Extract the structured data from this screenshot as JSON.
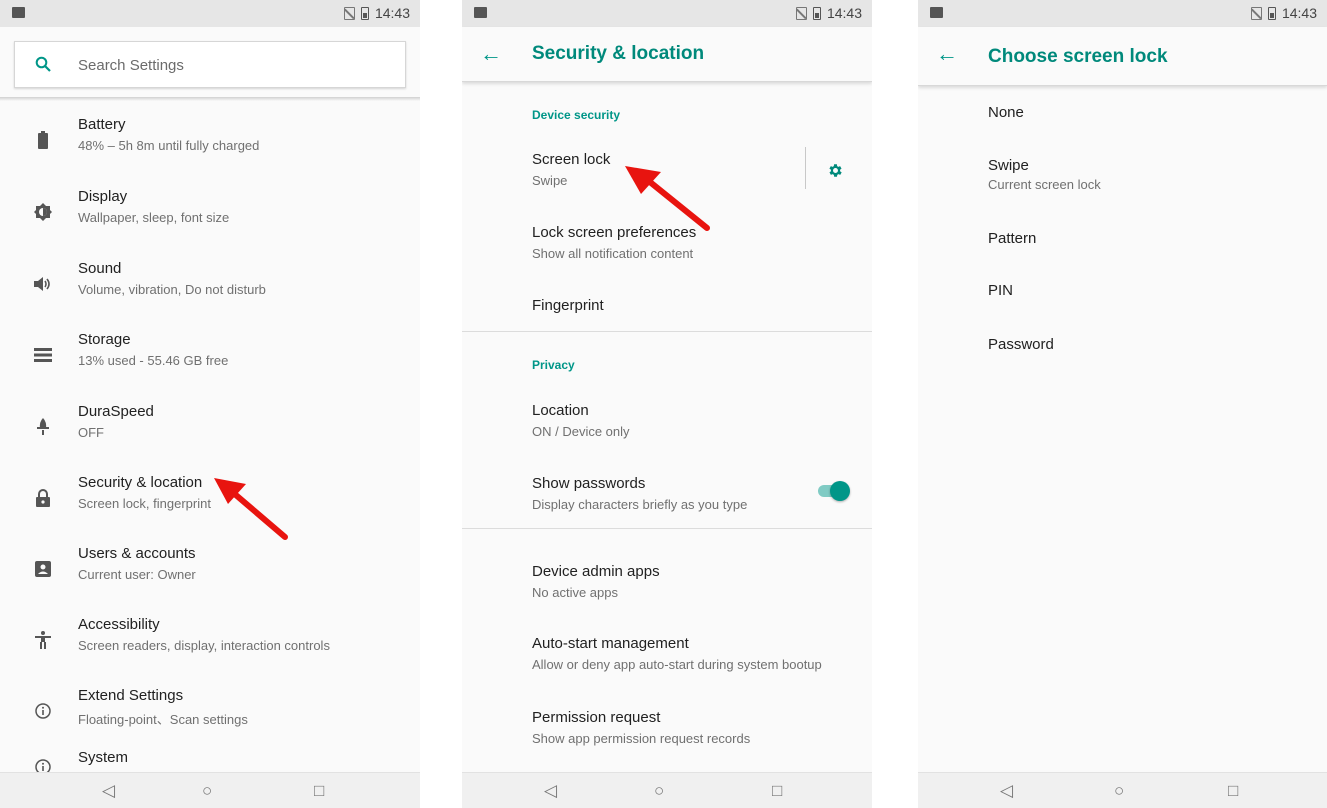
{
  "status_bar": {
    "time": "14:43"
  },
  "screen1": {
    "search_placeholder": "Search Settings",
    "items": [
      {
        "title": "Battery",
        "sub": "48% – 5h 8m until fully charged",
        "icon": "battery-icon"
      },
      {
        "title": "Display",
        "sub": "Wallpaper, sleep, font size",
        "icon": "brightness-icon"
      },
      {
        "title": "Sound",
        "sub": "Volume, vibration, Do not disturb",
        "icon": "volume-icon"
      },
      {
        "title": "Storage",
        "sub": "13% used - 55.46 GB free",
        "icon": "storage-icon"
      },
      {
        "title": "DuraSpeed",
        "sub": "OFF",
        "icon": "rocket-icon"
      },
      {
        "title": "Security & location",
        "sub": "Screen lock, fingerprint",
        "icon": "lock-icon"
      },
      {
        "title": "Users & accounts",
        "sub": "Current user: Owner",
        "icon": "account-icon"
      },
      {
        "title": "Accessibility",
        "sub": "Screen readers, display, interaction controls",
        "icon": "accessibility-icon"
      },
      {
        "title": "Extend Settings",
        "sub": "Floating-point、Scan settings",
        "icon": "info-icon"
      },
      {
        "title": "System",
        "sub": "",
        "icon": "info-icon"
      }
    ]
  },
  "screen2": {
    "title": "Security & location",
    "section_device": "Device security",
    "section_privacy": "Privacy",
    "items": {
      "screen_lock": {
        "title": "Screen lock",
        "sub": "Swipe"
      },
      "lock_prefs": {
        "title": "Lock screen preferences",
        "sub": "Show all notification content"
      },
      "fingerprint": {
        "title": "Fingerprint"
      },
      "location": {
        "title": "Location",
        "sub": "ON / Device only"
      },
      "show_passwords": {
        "title": "Show passwords",
        "sub": "Display characters briefly as you type",
        "enabled": true
      },
      "device_admin": {
        "title": "Device admin apps",
        "sub": "No active apps"
      },
      "auto_start": {
        "title": "Auto-start management",
        "sub": "Allow or deny app auto-start during system bootup"
      },
      "permission": {
        "title": "Permission request",
        "sub": "Show app permission request records"
      }
    }
  },
  "screen3": {
    "title": "Choose screen lock",
    "options": [
      {
        "title": "None"
      },
      {
        "title": "Swipe",
        "sub": "Current screen lock"
      },
      {
        "title": "Pattern"
      },
      {
        "title": "PIN"
      },
      {
        "title": "Password"
      }
    ]
  },
  "colors": {
    "accent": "#009688",
    "arrow": "#e8140f"
  }
}
